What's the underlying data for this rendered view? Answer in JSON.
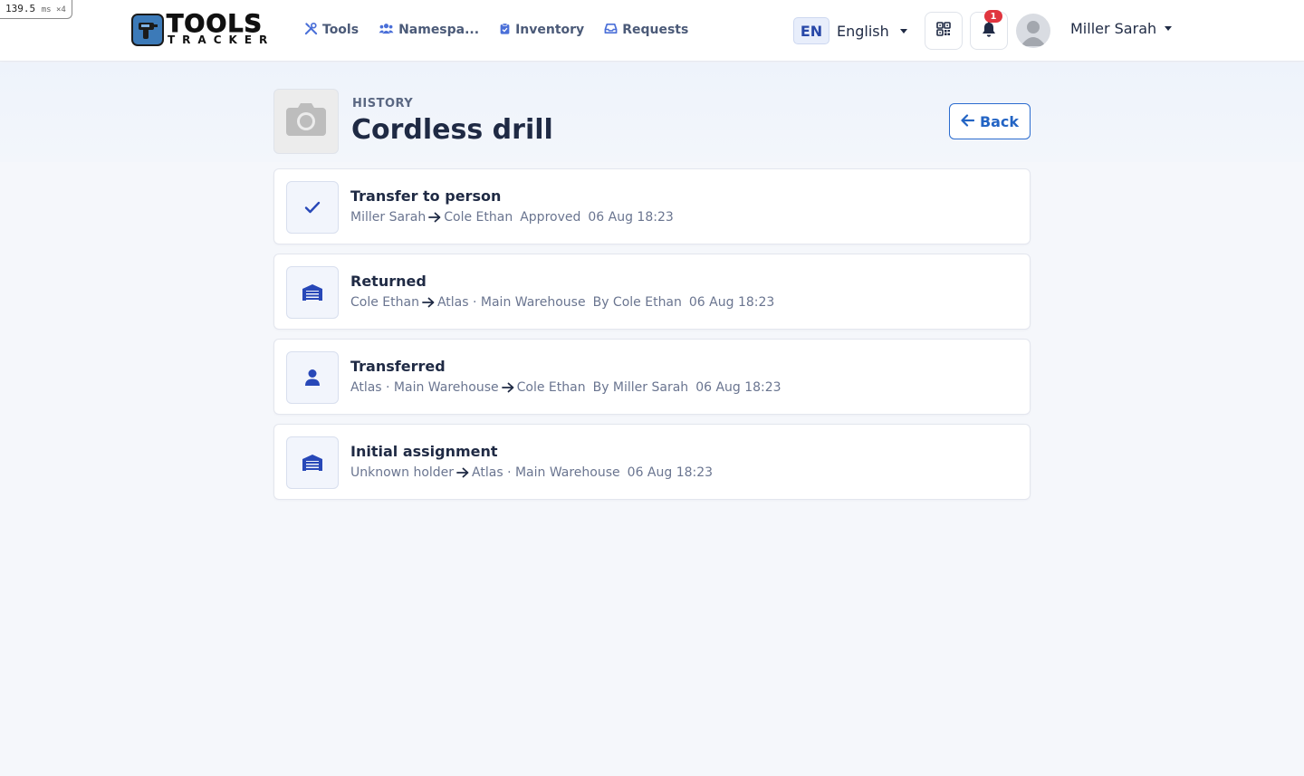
{
  "perf": {
    "value": "139.5",
    "unit": "ms ×4"
  },
  "brand": {
    "top": "TOOLS",
    "bottom": "TRACKER"
  },
  "nav": [
    {
      "label": "Tools",
      "icon": "tools-icon"
    },
    {
      "label": "Namespa...",
      "icon": "users-icon"
    },
    {
      "label": "Inventory",
      "icon": "clipboard-icon"
    },
    {
      "label": "Requests",
      "icon": "inbox-icon"
    }
  ],
  "language": {
    "code": "EN",
    "label": "English"
  },
  "notifications": {
    "count": "1"
  },
  "user": {
    "name": "Miller Sarah"
  },
  "page": {
    "eyebrow": "HISTORY",
    "title": "Cordless drill",
    "back_label": "Back"
  },
  "history": [
    {
      "title": "Transfer to person",
      "icon": "check-icon",
      "from": "Miller Sarah",
      "to": "Cole Ethan",
      "detail": "Approved",
      "time": "06 Aug 18:23"
    },
    {
      "title": "Returned",
      "icon": "warehouse-icon",
      "from": "Cole Ethan",
      "to": "Atlas · Main Warehouse",
      "detail": "By Cole Ethan",
      "time": "06 Aug 18:23"
    },
    {
      "title": "Transferred",
      "icon": "person-icon",
      "from": "Atlas · Main Warehouse",
      "to": "Cole Ethan",
      "detail": "By Miller Sarah",
      "time": "06 Aug 18:23"
    },
    {
      "title": "Initial assignment",
      "icon": "warehouse-icon",
      "from": "Unknown holder",
      "to": "Atlas · Main Warehouse",
      "detail": "",
      "time": "06 Aug 18:23"
    }
  ],
  "colors": {
    "accent": "#2364c4",
    "badge": "#e0353f",
    "icon_blue": "#2848b8"
  }
}
